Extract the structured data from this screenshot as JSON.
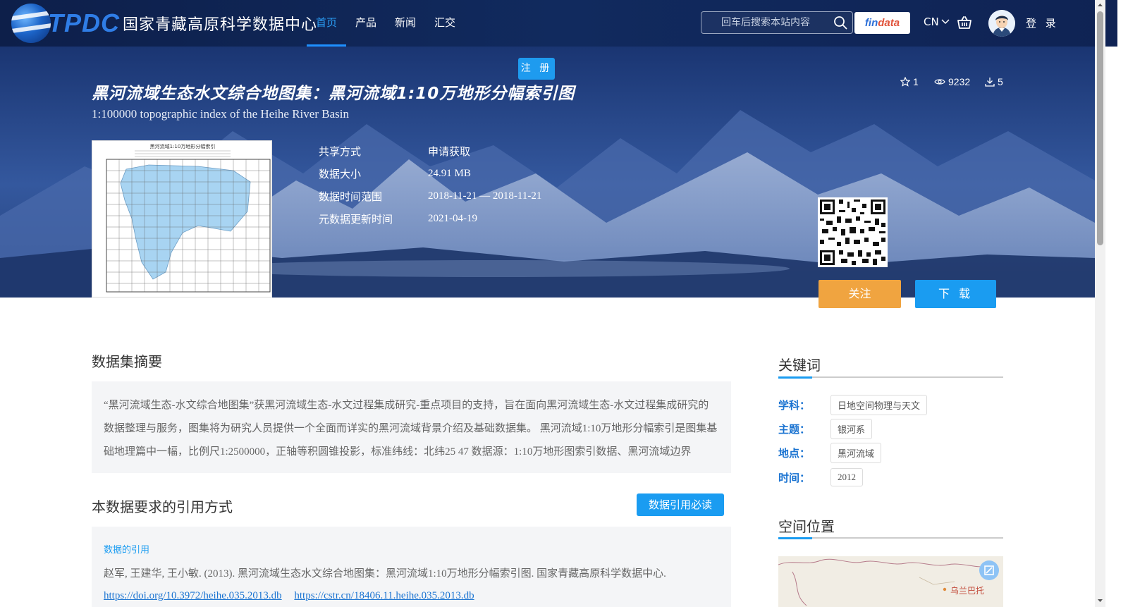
{
  "header": {
    "logo_letters": "TPDC",
    "logo_cn": "国家青藏高原科学数据中心",
    "nav": [
      {
        "label": "首页"
      },
      {
        "label": "产品"
      },
      {
        "label": "新闻"
      },
      {
        "label": "汇交"
      }
    ],
    "search_placeholder": "回车后搜索本站内容",
    "findata_part1": "fin",
    "findata_part2": "data",
    "lang": "CN",
    "login": "登 录"
  },
  "hero": {
    "register": "注 册",
    "title_cn": "黑河流域生态水文综合地图集：黑河流域1:10万地形分幅索引图",
    "title_en": "1:100000 topographic index of the Heihe River Basin",
    "stats": {
      "favorites": "1",
      "views": "9232",
      "downloads": "5"
    },
    "meta": [
      {
        "key": "共享方式",
        "value": "申请获取"
      },
      {
        "key": "数据大小",
        "value": "24.91 MB"
      },
      {
        "key": "数据时间范围",
        "value": "2018-11-21 — 2018-11-21"
      },
      {
        "key": "元数据更新时间",
        "value": "2021-04-19"
      }
    ],
    "thumb_caption": "黑河流域1:10万地形分幅索引",
    "follow": "关注",
    "download": "下 载"
  },
  "main": {
    "abstract_title": "数据集摘要",
    "abstract": "“黑河流域生态-水文综合地图集”获黑河流域生态-水文过程集成研究-重点项目的支持，旨在面向黑河流域生态-水文过程集成研究的数据整理与服务，图集将为研究人员提供一个全面而详实的黑河流域背景介绍及基础数据集。 黑河流域1:10万地形分幅索引是图集基础地理篇中一幅，比例尺1:2500000，正轴等积圆锥投影，标准纬线：北纬25 47 数据源：1:10万地形图索引数据、黑河流域边界",
    "citation_title": "本数据要求的引用方式",
    "citation_button": "数据引用必读",
    "citation_label": "数据的引用",
    "citation_text": "赵军, 王建华, 王小敏. (2013). 黑河流域生态水文综合地图集：黑河流域1:10万地形分幅索引图. 国家青藏高原科学数据中心.",
    "citation_links": [
      "https://doi.org/10.3972/heihe.035.2013.db",
      "https://cstr.cn/18406.11.heihe.035.2013.db"
    ]
  },
  "sidebar": {
    "keywords_title": "关键词",
    "keywords": [
      {
        "label": "学科：",
        "value": "日地空间物理与天文"
      },
      {
        "label": "主题：",
        "value": "银河系"
      },
      {
        "label": "地点：",
        "value": "黑河流域"
      },
      {
        "label": "时间：",
        "value": "2012"
      }
    ],
    "location_title": "空间位置",
    "map_label": "乌兰巴托"
  },
  "colors": {
    "accent": "#1a9cf1",
    "follow": "#f0a440",
    "header_bg": "#112a5e",
    "keyword_label": "#1a73d1"
  }
}
